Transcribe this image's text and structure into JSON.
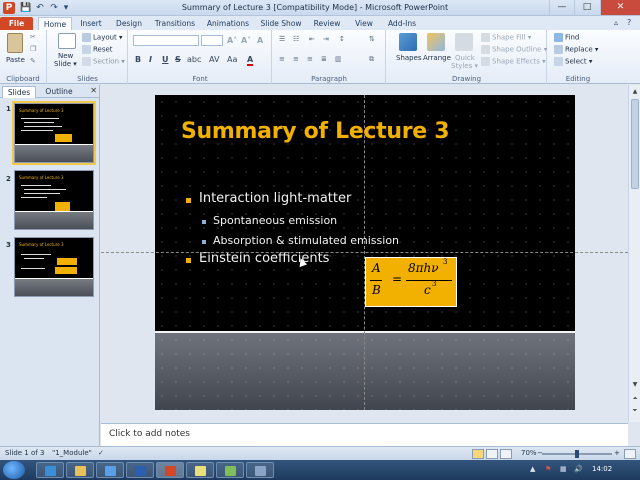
{
  "window": {
    "title": "Summary of Lecture 3 [Compatibility Mode]  -  Microsoft PowerPoint",
    "app_icon": "P",
    "controls": {
      "minimize": "—",
      "maximize": "□",
      "close": "✕"
    }
  },
  "quick_access": {
    "save_icon": "💾",
    "undo_icon": "↶",
    "redo_icon": "↷",
    "customize_icon": "▾"
  },
  "ribbon_tabs": [
    "File",
    "Home",
    "Insert",
    "Design",
    "Transitions",
    "Animations",
    "Slide Show",
    "Review",
    "View",
    "Add-Ins"
  ],
  "ribbon_right_icons": {
    "minimize_ribbon": "▵",
    "help": "?"
  },
  "ribbon": {
    "clipboard": {
      "paste": "Paste",
      "label": "Clipboard"
    },
    "slides": {
      "new_slide": "New",
      "new_slide2": "Slide ▾",
      "layout": "Layout ▾",
      "reset": "Reset",
      "section": "Section ▾",
      "label": "Slides"
    },
    "font": {
      "label": "Font",
      "grow": "A˄",
      "shrink": "A˅",
      "clear": "A",
      "bold": "B",
      "italic": "I",
      "underline": "U",
      "strike": "S",
      "shadow": "abc",
      "spacing": "AV",
      "case": "Aa",
      "color": "A"
    },
    "paragraph": {
      "label": "Paragraph"
    },
    "drawing": {
      "shapes": "Shapes",
      "arrange": "Arrange",
      "quick": "Quick",
      "styles": "Styles ▾",
      "fill": "Shape Fill ▾",
      "outline": "Shape Outline ▾",
      "effects": "Shape Effects ▾",
      "label": "Drawing"
    },
    "editing": {
      "find": "Find",
      "replace": "Replace ▾",
      "select": "Select ▾",
      "label": "Editing"
    }
  },
  "left_pane": {
    "tabs": [
      "Slides",
      "Outline"
    ],
    "close": "✕",
    "thumbnails": [
      {
        "num": "1",
        "title": "Summary of Lecture 3"
      },
      {
        "num": "2",
        "title": "Summary of Lecture 3"
      },
      {
        "num": "3",
        "title": "Summary of Lecture 3"
      }
    ]
  },
  "slide": {
    "title": "Summary of Lecture 3",
    "bullets": [
      {
        "level": 1,
        "text": "Interaction light-matter"
      },
      {
        "level": 2,
        "text": "Spontaneous emission"
      },
      {
        "level": 2,
        "text": "Absorption & stimulated emission"
      },
      {
        "level": 1,
        "text": "Einstein coefficients"
      }
    ],
    "formula": {
      "A": "A",
      "B": "B",
      "equals": "=",
      "numerator": "8πhν",
      "num_exp": "3",
      "denominator": "c",
      "den_exp": "3"
    }
  },
  "notes": {
    "placeholder": "Click to add notes"
  },
  "status_bar": {
    "slide_info": "Slide 1 of 3",
    "theme": "\"1_Module\"",
    "zoom": "70%",
    "minus": "−",
    "plus": "+",
    "zoom_level": 0.5
  },
  "taskbar": {
    "clock": "14:02",
    "tray_flag": "▲",
    "tray_volume": "🔊"
  }
}
